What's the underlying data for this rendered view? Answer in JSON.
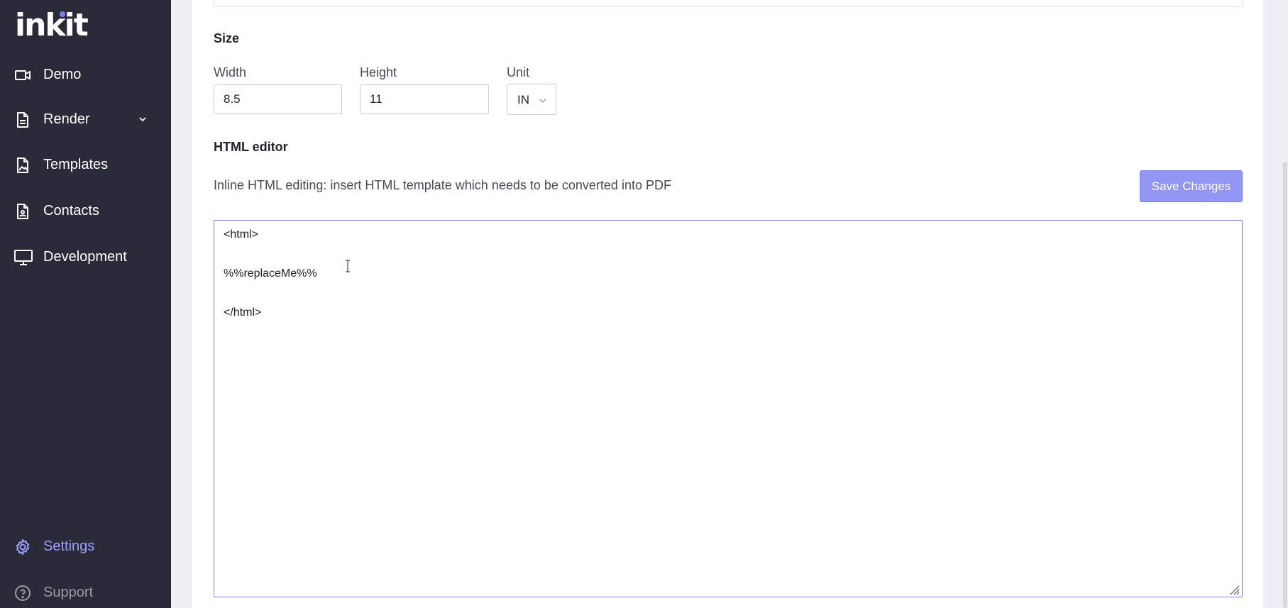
{
  "brand": {
    "logo_text": "inkit",
    "accent": "#7b7ff5"
  },
  "sidebar": {
    "items": [
      {
        "label": "Demo",
        "icon": "video-camera-icon"
      },
      {
        "label": "Render",
        "icon": "document-icon",
        "expandable": true
      },
      {
        "label": "Templates",
        "icon": "image-file-icon"
      },
      {
        "label": "Contacts",
        "icon": "contact-file-icon"
      },
      {
        "label": "Development",
        "icon": "monitor-icon"
      }
    ],
    "bottom_items": [
      {
        "label": "Settings",
        "icon": "gear-icon",
        "active": true
      },
      {
        "label": "Support",
        "icon": "help-circle-icon"
      }
    ]
  },
  "size": {
    "title": "Size",
    "width_label": "Width",
    "width_value": "8.5",
    "height_label": "Height",
    "height_value": "11",
    "unit_label": "Unit",
    "unit_value": "IN"
  },
  "html_editor": {
    "title": "HTML editor",
    "description": "Inline HTML editing: insert HTML template which needs to be converted into PDF",
    "save_label": "Save Changes",
    "lines": [
      "<html>",
      "%%replaceMe%%",
      "</html>"
    ]
  },
  "colors": {
    "sidebar_bg": "#2a2a38",
    "button_bg": "#9396f5",
    "active_nav": "#9aa0ff"
  }
}
